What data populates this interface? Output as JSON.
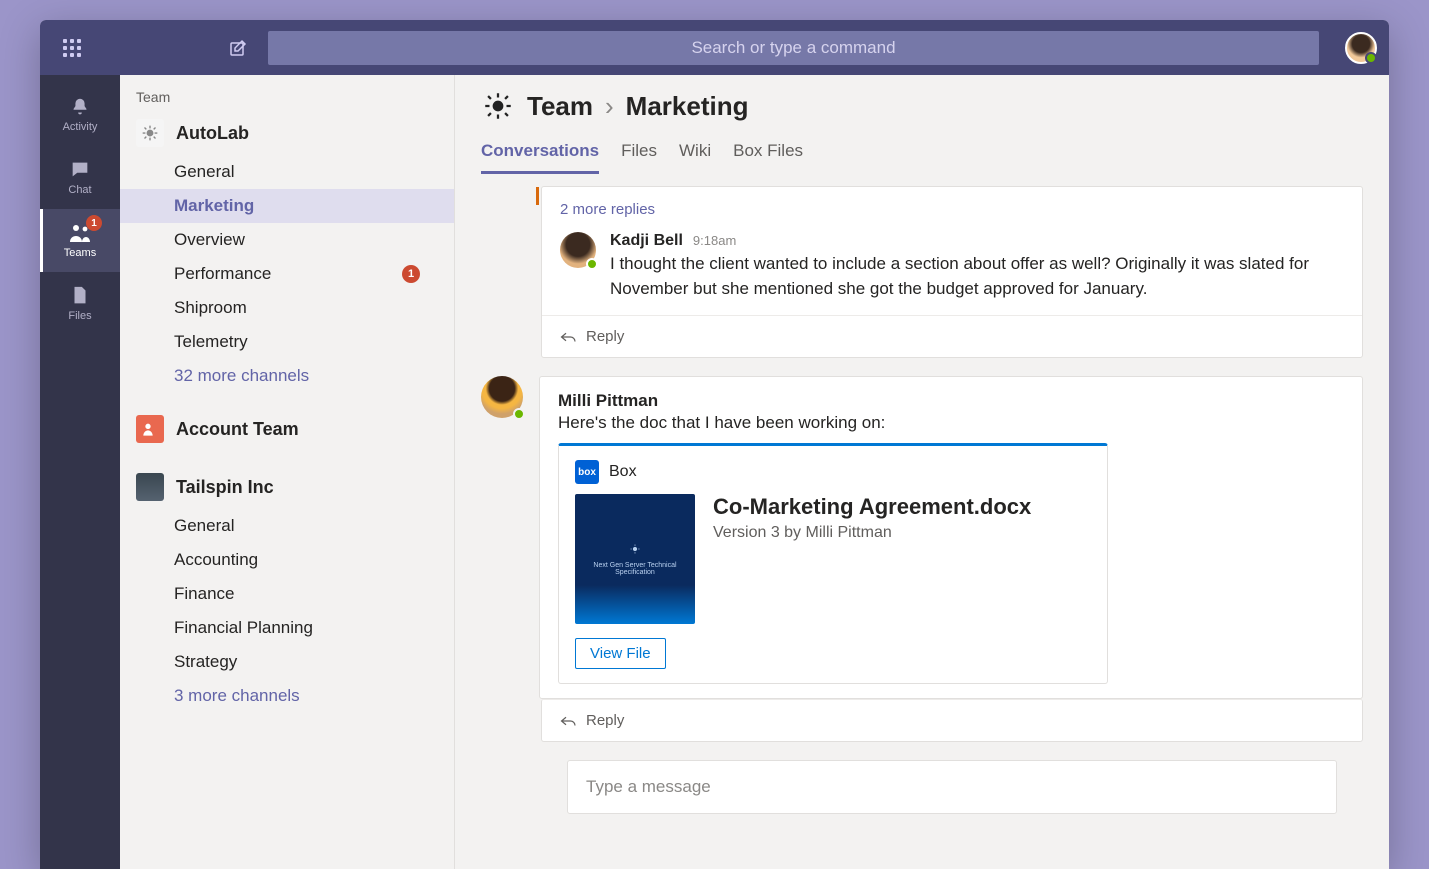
{
  "titlebar": {
    "search_placeholder": "Search or type a command"
  },
  "rail": {
    "items": [
      {
        "label": "Activity",
        "icon": "bell"
      },
      {
        "label": "Chat",
        "icon": "chat"
      },
      {
        "label": "Teams",
        "icon": "teams",
        "badge": "1",
        "active": true
      },
      {
        "label": "Files",
        "icon": "file"
      }
    ]
  },
  "sidebar": {
    "header": "Team",
    "teams": [
      {
        "name": "AutoLab",
        "avatar_class": "autolab",
        "channels": [
          {
            "label": "General"
          },
          {
            "label": "Marketing",
            "active": true
          },
          {
            "label": "Overview"
          },
          {
            "label": "Performance",
            "badge": "1"
          },
          {
            "label": "Shiproom"
          },
          {
            "label": "Telemetry"
          }
        ],
        "more_label": "32 more channels"
      },
      {
        "name": "Account Team",
        "avatar_class": "account",
        "channels": [],
        "more_label": ""
      },
      {
        "name": "Tailspin Inc",
        "avatar_class": "tailspin",
        "channels": [
          {
            "label": "General"
          },
          {
            "label": "Accounting"
          },
          {
            "label": "Finance"
          },
          {
            "label": "Financial Planning"
          },
          {
            "label": "Strategy"
          }
        ],
        "more_label": "3 more channels"
      }
    ]
  },
  "main": {
    "breadcrumb": {
      "team": "Team",
      "channel": "Marketing"
    },
    "tabs": [
      {
        "label": "Conversations",
        "active": true
      },
      {
        "label": "Files"
      },
      {
        "label": "Wiki"
      },
      {
        "label": "Box Files"
      }
    ]
  },
  "thread1": {
    "more_replies": "2 more replies",
    "reply": {
      "name": "Kadji Bell",
      "time": "9:18am",
      "text": "I thought the client wanted to include a section about offer as well? Originally it was slated for November but she mentioned she got the budget approved for January."
    },
    "reply_action": "Reply"
  },
  "post1": {
    "name": "Milli Pittman",
    "text": "Here's the doc that I have been working on:",
    "attachment": {
      "provider": "Box",
      "title": "Co-Marketing Agreement.docx",
      "subtitle": "Version 3 by Milli Pittman",
      "view_label": "View File"
    },
    "reply_action": "Reply"
  },
  "compose": {
    "placeholder": "Type a message"
  }
}
